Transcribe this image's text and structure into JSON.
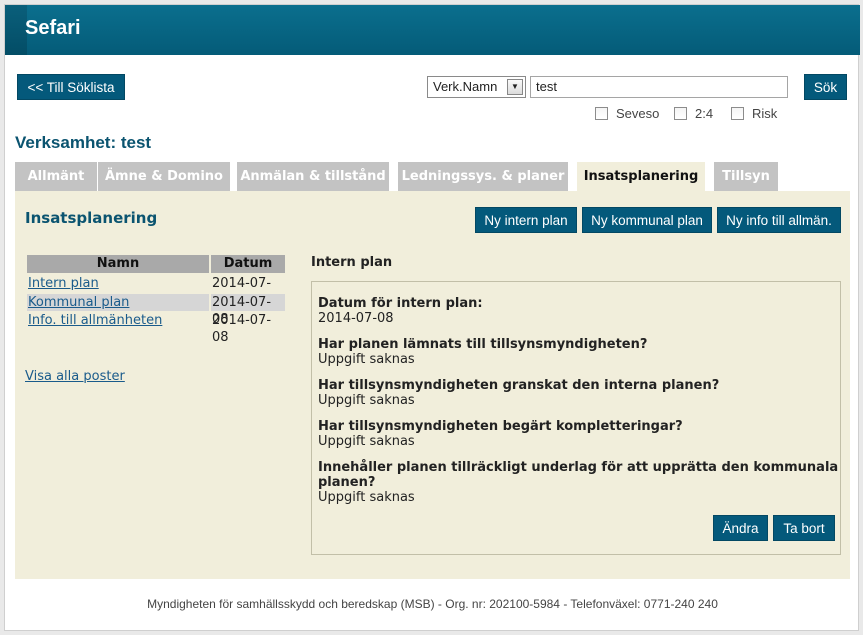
{
  "app": {
    "title": "Sefari"
  },
  "toolbar": {
    "back_label": "<< Till Söklista",
    "search_button": "Sök"
  },
  "search": {
    "field_select": "Verk.Namn",
    "query": "test",
    "filters": [
      {
        "label": "Seveso",
        "checked": false
      },
      {
        "label": "2:4",
        "checked": false
      },
      {
        "label": "Risk",
        "checked": false
      }
    ]
  },
  "verksamhet": {
    "heading": "Verksamhet: test"
  },
  "tabs": [
    {
      "label": "Allmänt",
      "active": false
    },
    {
      "label": "Ämne & Domino",
      "active": false
    },
    {
      "label": "Anmälan & tillstånd",
      "active": false
    },
    {
      "label": "Ledningssys. & planer",
      "active": false
    },
    {
      "label": "Insatsplanering",
      "active": true
    },
    {
      "label": "Tillsyn",
      "active": false
    }
  ],
  "panel": {
    "title": "Insatsplanering",
    "actions": {
      "new_intern": "Ny intern plan",
      "new_kommunal": "Ny kommunal plan",
      "new_info": "Ny info till allmän."
    },
    "list": {
      "headers": {
        "name": "Namn",
        "date": "Datum"
      },
      "rows": [
        {
          "name": "Intern plan",
          "date": "2014-07-08",
          "selected": false
        },
        {
          "name": "Kommunal plan",
          "date": "2014-07-08",
          "selected": true
        },
        {
          "name": "Info. till allmänheten",
          "date": "2014-07-08",
          "selected": false
        }
      ],
      "show_all": "Visa alla poster"
    },
    "detail": {
      "title": "Intern plan",
      "items": [
        {
          "question": "Datum för intern plan:",
          "answer": "2014-07-08"
        },
        {
          "question": "Har planen lämnats till tillsynsmyndigheten?",
          "answer": "Uppgift saknas"
        },
        {
          "question": "Har tillsynsmyndigheten granskat den interna planen?",
          "answer": "Uppgift saknas"
        },
        {
          "question": "Har tillsynsmyndigheten begärt kompletteringar?",
          "answer": "Uppgift saknas"
        },
        {
          "question": "Innehåller planen tillräckligt underlag för att upprätta den kommunala",
          "question_cont": "planen?",
          "answer": "Uppgift saknas"
        }
      ],
      "edit_label": "Ändra",
      "delete_label": "Ta bort"
    }
  },
  "footer": {
    "text": "Myndigheten för samhällsskydd och beredskap (MSB) - Org. nr: 202100-5984 - Telefonväxel: 0771-240 240"
  },
  "colors": {
    "brand": "#04597b",
    "panel": "#f1eedb",
    "tab_inactive": "#c3c3c3",
    "heading": "#0b5470"
  }
}
